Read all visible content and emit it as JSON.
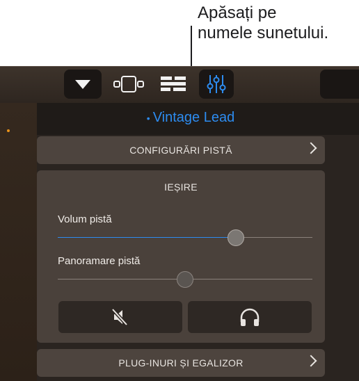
{
  "callout": {
    "text": "Apăsați pe\nnumele sunetului."
  },
  "toolbar": {
    "dropdown_icon": "triangle-down-icon",
    "views_icon": "track-view-icon",
    "list_icon": "list-editor-icon",
    "mixer_icon": "mixer-sliders-icon"
  },
  "sound": {
    "name": "Vintage Lead",
    "bullet": "•"
  },
  "sections": {
    "track_settings": "CONFIGURĂRI PISTĂ",
    "output": "IEȘIRE",
    "plugins_eq": "PLUG-INURI ȘI EGALIZOR"
  },
  "output": {
    "volume_label": "Volum pistă",
    "volume_value": 0.7,
    "pan_label": "Panoramare pistă",
    "pan_value": 0.5,
    "mute_icon": "speaker-mute-icon",
    "headphones_icon": "headphones-icon"
  },
  "colors": {
    "accent": "#2d8cf0",
    "panel": "#4a413b",
    "indicator": "#e8921a"
  }
}
